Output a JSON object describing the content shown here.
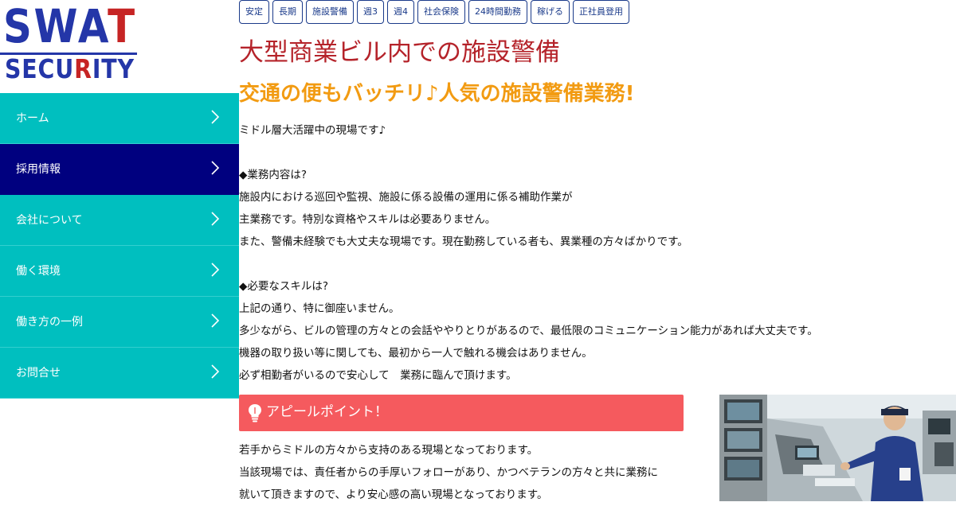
{
  "logo": {
    "line1_blue": "SWA",
    "line1_red": "T",
    "line2_blue": "SECU",
    "line2_red": "R",
    "line2_blue2": "ITY"
  },
  "nav": {
    "items": [
      {
        "label": "ホーム"
      },
      {
        "label": "採用情報"
      },
      {
        "label": "会社について"
      },
      {
        "label": "働く環境"
      },
      {
        "label": "働き方の一例"
      },
      {
        "label": "お問合せ"
      }
    ]
  },
  "tags": [
    "安定",
    "長期",
    "施設警備",
    "週3",
    "週4",
    "社会保険",
    "24時間勤務",
    "稼げる",
    "正社員登用"
  ],
  "job": {
    "title": "大型商業ビル内での施設警備",
    "subtitle": "交通の便もバッチリ♪人気の施設警備業務!",
    "paragraphs": [
      "ミドル層大活躍中の現場です♪",
      "",
      "◆業務内容は?",
      "施設内における巡回や監視、施設に係る設備の運用に係る補助作業が",
      "主業務です。特別な資格やスキルは必要ありません。",
      "また、警備未経験でも大丈夫な現場です。現在勤務している者も、異業種の方々ばかりです。",
      "",
      "◆必要なスキルは?",
      "上記の通り、特に御座いません。",
      "多少ながら、ビルの管理の方々との会話ややりとりがあるので、最低限のコミュニケーション能力があれば大丈夫です。",
      "機器の取り扱い等に関しても、最初から一人で触れる機会はありません。",
      "必ず相勤者がいるので安心して　業務に臨んで頂けます。"
    ]
  },
  "appeal": {
    "heading": "アピールポイント！",
    "paragraphs": [
      "若手からミドルの方々から支持のある現場となっております。",
      "当該現場では、責任者からの手厚いフォローがあり、かつベテランの方々と共に業務に",
      "就いて頂きますので、より安心感の高い現場となっております。"
    ]
  },
  "colors": {
    "nav_bg": "#00bfbf",
    "nav_active_bg": "#00007f",
    "tag_border": "#1a3a8a",
    "title": "#b5232a",
    "subtitle": "#f29b12",
    "appeal_bg": "#f55a5e",
    "logo_blue": "#2436a8",
    "logo_red": "#c62424"
  },
  "icons": {
    "nav_chevron": "chevron-right-icon",
    "appeal_icon": "lightbulb-icon"
  }
}
